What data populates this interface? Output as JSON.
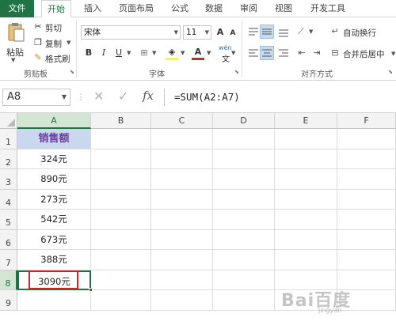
{
  "tabs": [
    "文件",
    "开始",
    "插入",
    "页面布局",
    "公式",
    "数据",
    "审阅",
    "视图",
    "开发工具"
  ],
  "active_tab": "开始",
  "ribbon": {
    "clipboard": {
      "paste": "粘贴",
      "cut": "剪切",
      "copy": "复制",
      "format_painter": "格式刷",
      "group_label": "剪贴板"
    },
    "font": {
      "font_name": "宋体",
      "font_size": "11",
      "grow": "A",
      "shrink": "A",
      "bold": "B",
      "italic": "I",
      "underline": "U",
      "font_color": "A",
      "phonetic": "wén",
      "group_label": "字体"
    },
    "alignment": {
      "wrap_text": "自动换行",
      "merge_center": "合并后居中",
      "group_label": "对齐方式"
    }
  },
  "formula_bar": {
    "name_box": "A8",
    "formula": "=SUM(A2:A7)",
    "fx": "fx"
  },
  "grid": {
    "columns": [
      "A",
      "B",
      "C",
      "D",
      "E",
      "F"
    ],
    "rows": [
      "1",
      "2",
      "3",
      "4",
      "5",
      "6",
      "7",
      "8",
      "9"
    ],
    "selected_column": "A",
    "selected_row": "8",
    "column_a_values": [
      "销售额",
      "324元",
      "890元",
      "273元",
      "542元",
      "673元",
      "388元",
      "3090元",
      ""
    ]
  },
  "colors": {
    "accent": "#217346",
    "header_fill": "#c9d8ee",
    "header_text": "#6a3fa0",
    "highlight_border": "#d72020"
  },
  "watermark": {
    "text": "Bai百度",
    "sub": "jingyan"
  }
}
